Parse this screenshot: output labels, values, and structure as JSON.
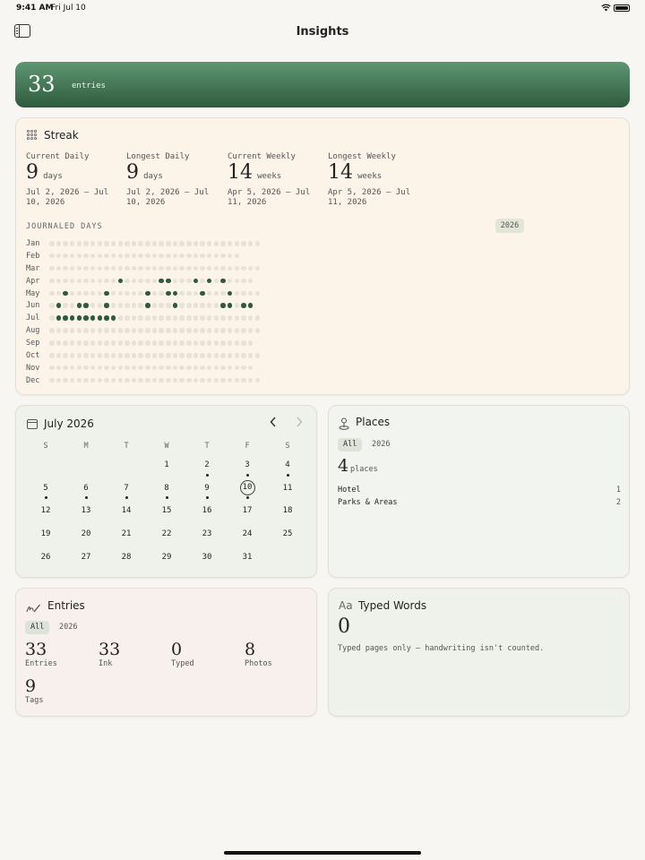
{
  "status": {
    "time": "9:41 AM",
    "date": "Fri Jul 10"
  },
  "nav": {
    "title": "Insights"
  },
  "banner": {
    "count": "33",
    "label": "entries"
  },
  "streak": {
    "title": "Streak",
    "stats": [
      {
        "label": "Current Daily",
        "value": "9",
        "unit": "days",
        "range": "Jul 2, 2026 – Jul 10, 2026"
      },
      {
        "label": "Longest Daily",
        "value": "9",
        "unit": "days",
        "range": "Jul 2, 2026 – Jul 10, 2026"
      },
      {
        "label": "Current Weekly",
        "value": "14",
        "unit": "weeks",
        "range": "Apr 5, 2026 – Jul 11, 2026"
      },
      {
        "label": "Longest Weekly",
        "value": "14",
        "unit": "weeks",
        "range": "Apr 5, 2026 – Jul 11, 2026"
      }
    ],
    "journaled_label": "JOURNALED DAYS",
    "year": "2026",
    "months": [
      {
        "name": "Jan",
        "days": 31,
        "on": []
      },
      {
        "name": "Feb",
        "days": 28,
        "on": []
      },
      {
        "name": "Mar",
        "days": 31,
        "on": []
      },
      {
        "name": "Apr",
        "days": 30,
        "on": [
          11,
          17,
          18,
          22,
          24,
          26
        ]
      },
      {
        "name": "May",
        "days": 31,
        "on": [
          3,
          9,
          15,
          18,
          19,
          23,
          27
        ]
      },
      {
        "name": "Jun",
        "days": 30,
        "on": [
          2,
          5,
          6,
          9,
          15,
          19,
          26,
          27,
          29,
          30
        ]
      },
      {
        "name": "Jul",
        "days": 31,
        "on": [
          2,
          3,
          4,
          5,
          6,
          7,
          8,
          9,
          10
        ]
      },
      {
        "name": "Aug",
        "days": 31,
        "on": []
      },
      {
        "name": "Sep",
        "days": 30,
        "on": []
      },
      {
        "name": "Oct",
        "days": 31,
        "on": []
      },
      {
        "name": "Nov",
        "days": 30,
        "on": []
      },
      {
        "name": "Dec",
        "days": 31,
        "on": []
      }
    ]
  },
  "calendar": {
    "title": "July 2026",
    "weekdays": [
      "S",
      "M",
      "T",
      "W",
      "T",
      "F",
      "S"
    ],
    "first_weekday": 3,
    "days_in_month": 31,
    "today": 10,
    "marked": [
      2,
      3,
      4,
      5,
      6,
      7,
      8,
      9,
      10
    ]
  },
  "places": {
    "title": "Places",
    "filters": [
      "All",
      "2026"
    ],
    "count": "4",
    "count_label": "places",
    "rows": [
      {
        "name": "Hotel",
        "count": "1"
      },
      {
        "name": "Parks & Areas",
        "count": "2"
      }
    ]
  },
  "entries": {
    "title": "Entries",
    "filters": [
      "All",
      "2026"
    ],
    "stats": [
      {
        "value": "33",
        "label": "Entries"
      },
      {
        "value": "33",
        "label": "Ink"
      },
      {
        "value": "0",
        "label": "Typed"
      },
      {
        "value": "8",
        "label": "Photos"
      },
      {
        "value": "9",
        "label": "Tags"
      }
    ]
  },
  "words": {
    "icon_text": "Aa",
    "title": "Typed Words",
    "count": "0",
    "note": "Typed pages only — handwriting isn't counted."
  }
}
